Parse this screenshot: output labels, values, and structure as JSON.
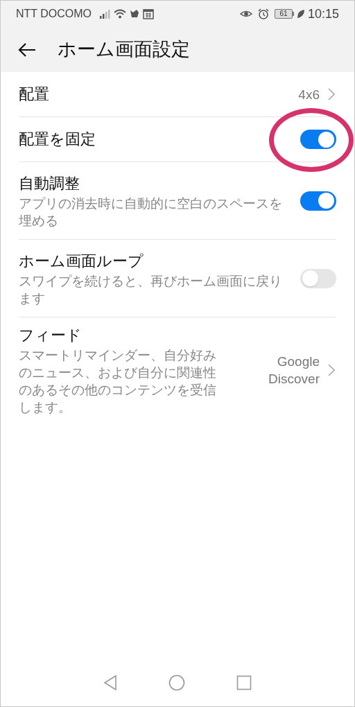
{
  "status_bar": {
    "carrier": "NTT DOCOMO",
    "battery": "61",
    "time": "10:15"
  },
  "header": {
    "title": "ホーム画面設定"
  },
  "items": [
    {
      "kind": "value",
      "title": "配置",
      "value": "4x6"
    },
    {
      "kind": "toggle",
      "title": "配置を固定",
      "on": true,
      "highlighted": true
    },
    {
      "kind": "toggle",
      "title": "自動調整",
      "description": "アプリの消去時に自動的に空白のスペースを埋める",
      "on": true
    },
    {
      "kind": "toggle",
      "title": "ホーム画面ループ",
      "description": "スワイプを続けると、再びホーム画面に戻ります",
      "on": false
    },
    {
      "kind": "value",
      "title": "フィード",
      "description": "スマートリマインダー、自分好みのニュース、および自分に関連性のあるその他のコンテンツを受信します。",
      "value": "Google Discover"
    }
  ]
}
